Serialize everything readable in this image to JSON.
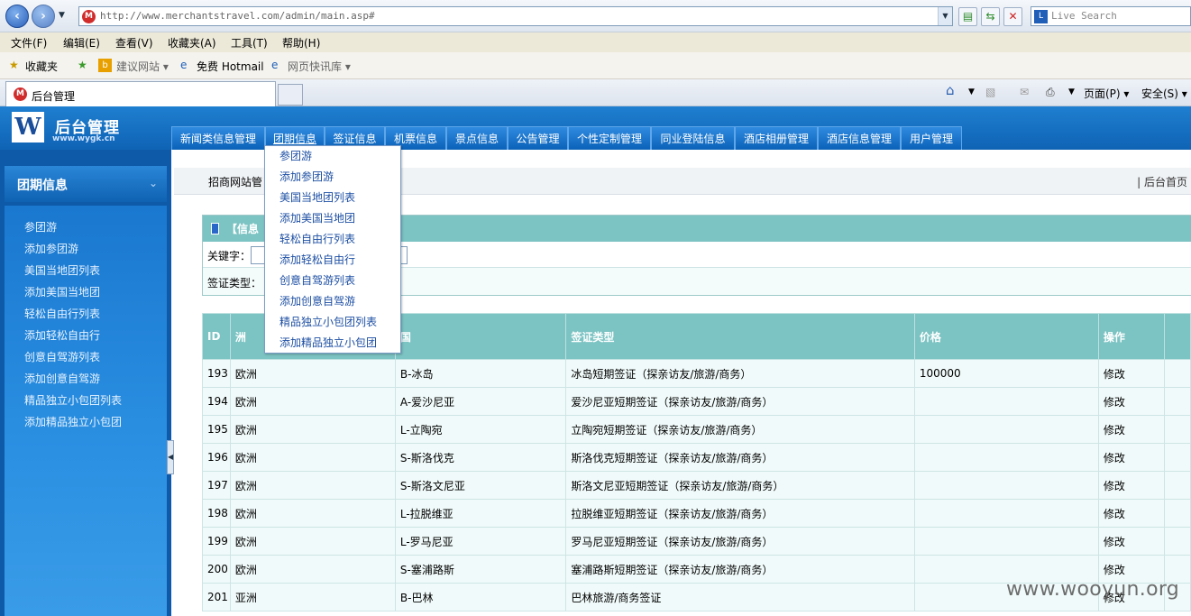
{
  "browser": {
    "url": "http://www.merchantstravel.com/admin/main.asp#",
    "search_placeholder": "Live Search",
    "menu": [
      "文件(F)",
      "编辑(E)",
      "查看(V)",
      "收藏夹(A)",
      "工具(T)",
      "帮助(H)"
    ],
    "favorites": {
      "fav_label": "收藏夹",
      "suggested": "建议网站 ▾",
      "hotmail": "免费 Hotmail",
      "webslice": "网页快讯库 ▾"
    },
    "tab_title": "后台管理",
    "commands": {
      "page": "页面(P) ▾",
      "safety": "安全(S) ▾"
    }
  },
  "app": {
    "logo_letter": "W",
    "logo_title": "后台管理",
    "logo_url": "www.wygk.cn",
    "nav": [
      "新闻类信息管理",
      "团期信息",
      "签证信息",
      "机票信息",
      "景点信息",
      "公告管理",
      "个性定制管理",
      "同业登陆信息",
      "酒店相册管理",
      "酒店信息管理",
      "用户管理"
    ]
  },
  "sidebar": {
    "title": "团期信息",
    "links": [
      "参团游",
      "添加参团游",
      "美国当地团列表",
      "添加美国当地团",
      "轻松自由行列表",
      "添加轻松自由行",
      "创意自驾游列表",
      "添加创意自驾游",
      "精品独立小包团列表",
      "添加精品独立小包团"
    ]
  },
  "main": {
    "crumb": "招商网站管",
    "home_link": "| 后台首页",
    "info_title": "【信息",
    "keyword_label": "关键字：",
    "visa_type_label": "签证类型：",
    "table": {
      "headers": [
        "ID",
        "洲",
        "国",
        "签证类型",
        "价格",
        "操作"
      ],
      "rows": [
        [
          "193",
          "欧洲",
          "B-冰岛",
          "冰岛短期签证（探亲访友/旅游/商务）",
          "100000",
          "修改"
        ],
        [
          "194",
          "欧洲",
          "A-爱沙尼亚",
          "爱沙尼亚短期签证（探亲访友/旅游/商务）",
          "",
          "修改"
        ],
        [
          "195",
          "欧洲",
          "L-立陶宛",
          "立陶宛短期签证（探亲访友/旅游/商务）",
          "",
          "修改"
        ],
        [
          "196",
          "欧洲",
          "S-斯洛伐克",
          "斯洛伐克短期签证（探亲访友/旅游/商务）",
          "",
          "修改"
        ],
        [
          "197",
          "欧洲",
          "S-斯洛文尼亚",
          "斯洛文尼亚短期签证（探亲访友/旅游/商务）",
          "",
          "修改"
        ],
        [
          "198",
          "欧洲",
          "L-拉脱维亚",
          "拉脱维亚短期签证（探亲访友/旅游/商务）",
          "",
          "修改"
        ],
        [
          "199",
          "欧洲",
          "L-罗马尼亚",
          "罗马尼亚短期签证（探亲访友/旅游/商务）",
          "",
          "修改"
        ],
        [
          "200",
          "欧洲",
          "S-塞浦路斯",
          "塞浦路斯短期签证（探亲访友/旅游/商务）",
          "",
          "修改"
        ],
        [
          "201",
          "亚洲",
          "B-巴林",
          "巴林旅游/商务签证",
          "",
          "修改"
        ]
      ]
    }
  },
  "dropdown": [
    "参团游",
    "添加参团游",
    "美国当地团列表",
    "添加美国当地团",
    "轻松自由行列表",
    "添加轻松自由行",
    "创意自驾游列表",
    "添加创意自驾游",
    "精品独立小包团列表",
    "添加精品独立小包团"
  ],
  "watermark": "www.wooyun.org"
}
